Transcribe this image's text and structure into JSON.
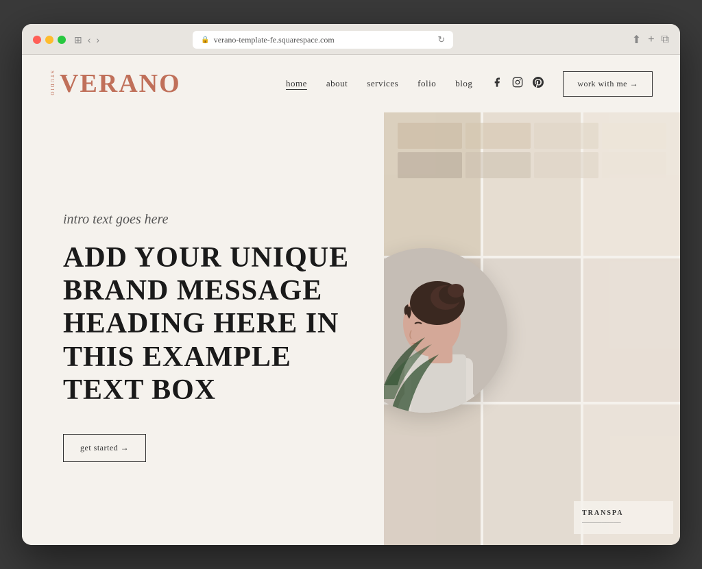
{
  "browser": {
    "url": "verano-template-fe.squarespace.com",
    "controls": {
      "back": "‹",
      "forward": "›",
      "share": "⎋",
      "new_tab": "+",
      "duplicate": "⧉"
    }
  },
  "logo": {
    "side_text": "STUDIO",
    "main_text": "VERANO"
  },
  "nav": {
    "links": [
      {
        "label": "home",
        "active": true
      },
      {
        "label": "about",
        "active": false
      },
      {
        "label": "services",
        "active": false
      },
      {
        "label": "folio",
        "active": false
      },
      {
        "label": "blog",
        "active": false
      }
    ],
    "social": [
      {
        "name": "facebook-icon",
        "symbol": "f"
      },
      {
        "name": "instagram-icon",
        "symbol": "⬜"
      },
      {
        "name": "pinterest-icon",
        "symbol": "𝕻"
      }
    ],
    "cta": "work with me →"
  },
  "hero": {
    "intro": "intro text goes here",
    "heading": "ADD YOUR UNIQUE BRAND MESSAGE HEADING HERE IN THIS EXAMPLE TEXT BOX",
    "cta_button": "get started →"
  },
  "colors": {
    "logo": "#c0705a",
    "bg": "#f5f2ed",
    "text_dark": "#1a1a1a",
    "text_mid": "#555555"
  }
}
